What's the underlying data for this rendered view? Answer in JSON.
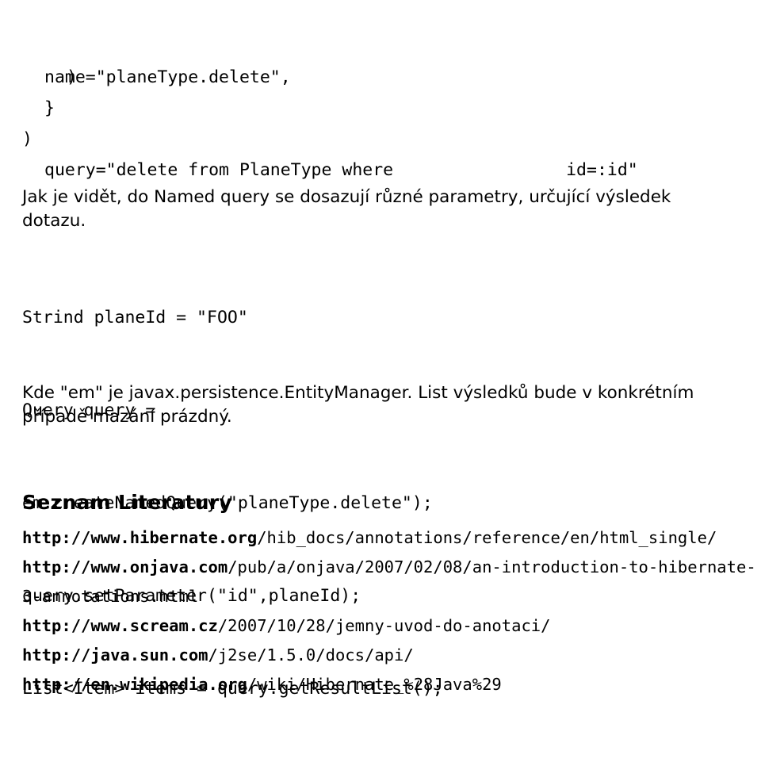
{
  "document": {
    "code_top": {
      "line1": "name=\"planeType.delete\",",
      "line2_left": "query=\"delete from PlaneType where",
      "line2_right": "id=:id\"",
      "line3": ")",
      "line4": "}",
      "line5": ")"
    },
    "paragraph1": "Jak je vidět, do Named query se dosazují různé parametry, určující výsledek dotazu.",
    "code_mid": {
      "line1": "Strind planeId = \"FOO\"",
      "line2": "Query query =",
      "line3": "em.createNamedQuery(\"planeType.delete\");",
      "line4": "query.setParameter(\"id\",planeId);",
      "line5": "List<Item> items = query.getResultList();",
      "line6": "Kde \"em\" je javax.persistence.EntityManager. List výsledků bude v konkrétním",
      "line7": "případě mazání prázdný."
    },
    "heading": "Seznam Literatury",
    "links": [
      {
        "bold": "http://www.hibernate.org",
        "rest": "/hib_docs/annotations/reference/en/html_single/"
      },
      {
        "bold": "http://www.onjava.com",
        "rest": "/pub/a/onjava/2007/02/08/an-introduction-to-hibernate-3-annotations.html"
      },
      {
        "bold": "http://www.scream.cz",
        "rest": "/2007/10/28/jemny-uvod-do-anotaci/"
      },
      {
        "bold": "http://java.sun.com",
        "rest": "/j2se/1.5.0/docs/api/"
      },
      {
        "bold": "http://en.wikipedia.org",
        "rest": "/wiki/Hibernate_%28Java%29"
      }
    ]
  }
}
